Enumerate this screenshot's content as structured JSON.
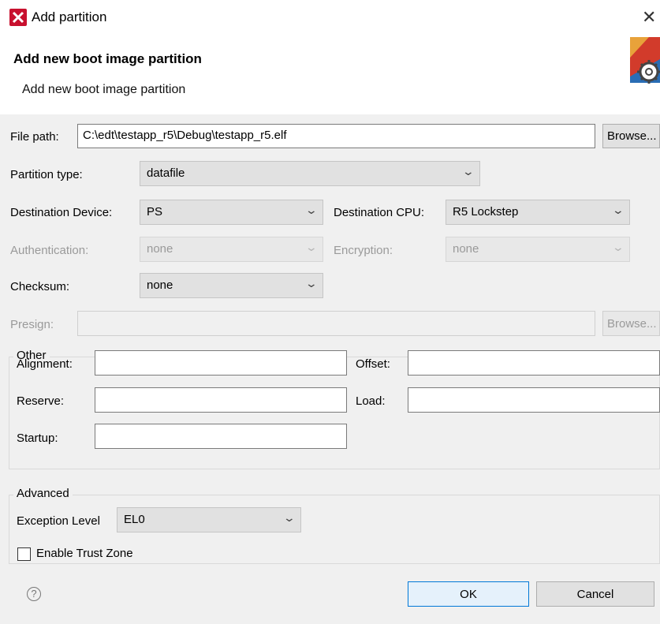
{
  "window": {
    "title": "Add partition",
    "close_glyph": "✕"
  },
  "header": {
    "title": "Add new boot image partition",
    "subtitle": "Add new boot image partition",
    "icon": "wizard-gear-icon"
  },
  "form": {
    "file_path": {
      "label": "File path:",
      "value": "C:\\edt\\testapp_r5\\Debug\\testapp_r5.elf",
      "browse": "Browse..."
    },
    "partition_type": {
      "label": "Partition type:",
      "value": "datafile"
    },
    "destination_device": {
      "label": "Destination Device:",
      "value": "PS"
    },
    "destination_cpu": {
      "label": "Destination CPU:",
      "value": "R5 Lockstep"
    },
    "authentication": {
      "label": "Authentication:",
      "value": "none"
    },
    "encryption": {
      "label": "Encryption:",
      "value": "none"
    },
    "checksum": {
      "label": "Checksum:",
      "value": "none"
    },
    "presign": {
      "label": "Presign:",
      "value": "",
      "browse": "Browse..."
    }
  },
  "other": {
    "title": "Other",
    "alignment": {
      "label": "Alignment:",
      "value": ""
    },
    "offset": {
      "label": "Offset:",
      "value": ""
    },
    "reserve": {
      "label": "Reserve:",
      "value": ""
    },
    "load": {
      "label": "Load:",
      "value": ""
    },
    "startup": {
      "label": "Startup:",
      "value": ""
    }
  },
  "advanced": {
    "title": "Advanced",
    "exception_level": {
      "label": "Exception Level",
      "value": "EL0"
    },
    "trust_zone": {
      "label": "Enable Trust Zone",
      "checked": false
    }
  },
  "footer": {
    "help_glyph": "?",
    "ok": "OK",
    "cancel": "Cancel"
  }
}
